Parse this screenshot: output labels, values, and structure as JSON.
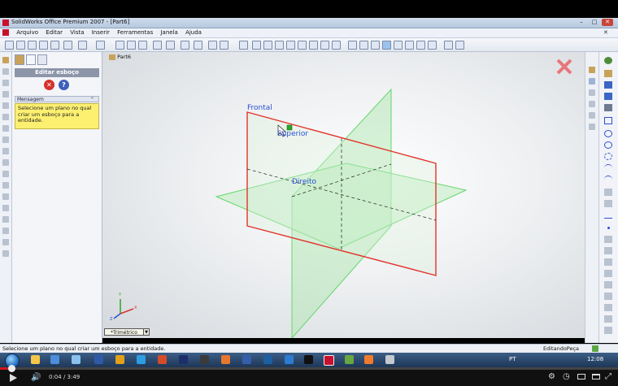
{
  "window": {
    "title": "SolidWorks Office Premium 2007 - [Part6]"
  },
  "menu": [
    "Arquivo",
    "Editar",
    "Vista",
    "Inserir",
    "Ferramentas",
    "Janela",
    "Ajuda"
  ],
  "panel": {
    "header": "Editar esboço",
    "message_heading": "Mensagem",
    "message_text": "Selecione um plano no qual criar um esboço para a entidade."
  },
  "graphics": {
    "tree_item": "Part6",
    "plane_labels": {
      "front": "Frontal",
      "top": "Superior",
      "right": "Direito"
    },
    "view_orientation": "*Trimétrico",
    "triad_labels": {
      "y": "Y",
      "x": "X",
      "z": "Z"
    }
  },
  "statusbar": {
    "message": "Selecione um plano no qual criar um esboço para a entidade.",
    "mode": "EditandoPeça"
  },
  "taskbar": {
    "language": "PT",
    "clock": "12:08"
  },
  "player": {
    "time": "0:04 / 3:49",
    "progress_fraction": 0.018
  },
  "colors": {
    "front_plane": "#e3332a",
    "other_planes": "#64d66a",
    "plane_label": "#2a4fd2",
    "message_bg": "#fdf071"
  }
}
